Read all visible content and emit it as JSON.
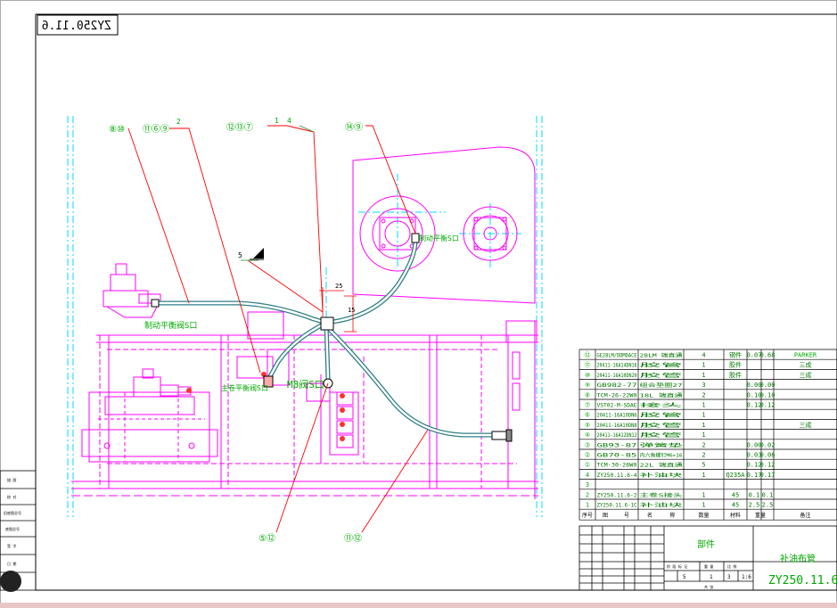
{
  "drawing": {
    "corner_code_mirrored": "ZY250.11.6",
    "drawing_number": "ZY250.11.6",
    "drawing_title": "补油布管",
    "part_group_label": "部件",
    "colors": {
      "frame": "#000000",
      "equipment": "#ff00ff",
      "leader": "#ff0000",
      "text": "#00aa00",
      "pipe": "#2f7f86",
      "centerline": "#00d8ff"
    }
  },
  "callouts": [
    {
      "label": "⑧⑩"
    },
    {
      "label": "⑪⑥⑨"
    },
    {
      "label": "⑫⑬⑦"
    },
    {
      "label": "⑭⑨"
    },
    {
      "label": "⑤⑫"
    },
    {
      "label": "⑪⑫"
    }
  ],
  "callout_numbers": {
    "n2": "2",
    "n1": "1",
    "n4": "4",
    "n5": "5"
  },
  "port_labels": {
    "left_port": "制动平衡阀S口",
    "main_balance": "主卷平衡阀S口",
    "m8": "M8阀S口",
    "right_port": "制动平衡S口"
  },
  "dims": {
    "d25": "25",
    "d15": "15"
  },
  "bom": {
    "header": {
      "c1": "序号",
      "c2": "图",
      "c3": "号",
      "c4": "名",
      "c5": "称",
      "c6": "数量",
      "c7": "材料",
      "c8": "重量",
      "c9": "备注"
    },
    "rows": [
      {
        "no": "⑫",
        "code": "GE28LM/DDMDACE",
        "name": "28LM 端直通",
        "qty": "4",
        "mat": "钢件",
        "w1": "0.07",
        "w2": "0.68",
        "note": "PARKER"
      },
      {
        "no": "⑪",
        "code": "20411-16A14DN16",
        "name": "胶管",
        "qty": "1",
        "mat": "胶件",
        "w1": "",
        "w2": "",
        "note": "三成"
      },
      {
        "no": "⑩",
        "code": "20411-16A10DN20",
        "name": "胶管",
        "qty": "1",
        "mat": "胶件",
        "w1": "",
        "w2": "",
        "note": "三成"
      },
      {
        "no": "⑨",
        "code": "GB982-77",
        "name": "组合垫圈27",
        "qty": "3",
        "mat": "",
        "w1": "0.00",
        "w2": "0.00",
        "note": ""
      },
      {
        "no": "⑧",
        "code": "TCM-26-22W0",
        "name": "18L 端直通",
        "qty": "2",
        "mat": "",
        "w1": "0.10",
        "w2": "0.10",
        "note": ""
      },
      {
        "no": "⑦",
        "code": "VST02-M-SDAE",
        "name": "接头",
        "qty": "1",
        "mat": "",
        "w1": "0.12",
        "w2": "0.12",
        "note": ""
      },
      {
        "no": "⑥",
        "code": "20411-16A10DN6",
        "name": "胶管",
        "qty": "1",
        "mat": "",
        "w1": "",
        "w2": "",
        "note": ""
      },
      {
        "no": "⑤",
        "code": "20411-16A10DN8",
        "name": "胶管",
        "qty": "1",
        "mat": "",
        "w1": "",
        "w2": "",
        "note": "三成"
      },
      {
        "no": "④",
        "code": "20411-16A12DN12",
        "name": "胶管",
        "qty": "1",
        "mat": "",
        "w1": "",
        "w2": "",
        "note": ""
      },
      {
        "no": "③",
        "code": "GB93-87",
        "name": "弹簧垫",
        "qty": "2",
        "mat": "",
        "w1": "0.00",
        "w2": "0.02",
        "note": ""
      },
      {
        "no": "②",
        "code": "GB70-85",
        "name": "内六角螺钉M6×16",
        "qty": "2",
        "mat": "",
        "w1": "0.03",
        "w2": "0.06",
        "note": ""
      },
      {
        "no": "①",
        "code": "TCM-30-26W0",
        "name": "22L 端直通",
        "qty": "5",
        "mat": "",
        "w1": "0.12",
        "w2": "0.12",
        "note": ""
      },
      {
        "no": "4",
        "code": "ZY250.11.6-4",
        "name": "补油块",
        "qty": "1",
        "mat": "Q235A",
        "w1": "0.17",
        "w2": "0.17",
        "note": ""
      },
      {
        "no": "3",
        "code": "",
        "name": "",
        "qty": "",
        "mat": "",
        "w1": "",
        "w2": "",
        "note": ""
      },
      {
        "no": "2",
        "code": "ZY250.11.6-2",
        "name": "主卷S接头",
        "qty": "1",
        "mat": "45",
        "w1": "0.1",
        "w2": "0.1",
        "note": ""
      },
      {
        "no": "1",
        "code": "ZY250.11.6-1C",
        "name": "补油块",
        "qty": "1",
        "mat": "45",
        "w1": "2.5",
        "w2": "2.5",
        "note": ""
      }
    ]
  },
  "title_block": {
    "scale_row": {
      "a": "5",
      "b": "1",
      "c": "3",
      "d": "1:6"
    },
    "stage_labels": {
      "s1": "阶 段 标 记",
      "s2": "重 量",
      "s3": "比 例"
    },
    "sheet_label": "共 张"
  },
  "left_stamps": {
    "s1": "描 图",
    "s2": "校 对",
    "s3": "旧底图总号",
    "s4": "底图总号",
    "s5": "签 字",
    "s6": "日 期"
  }
}
